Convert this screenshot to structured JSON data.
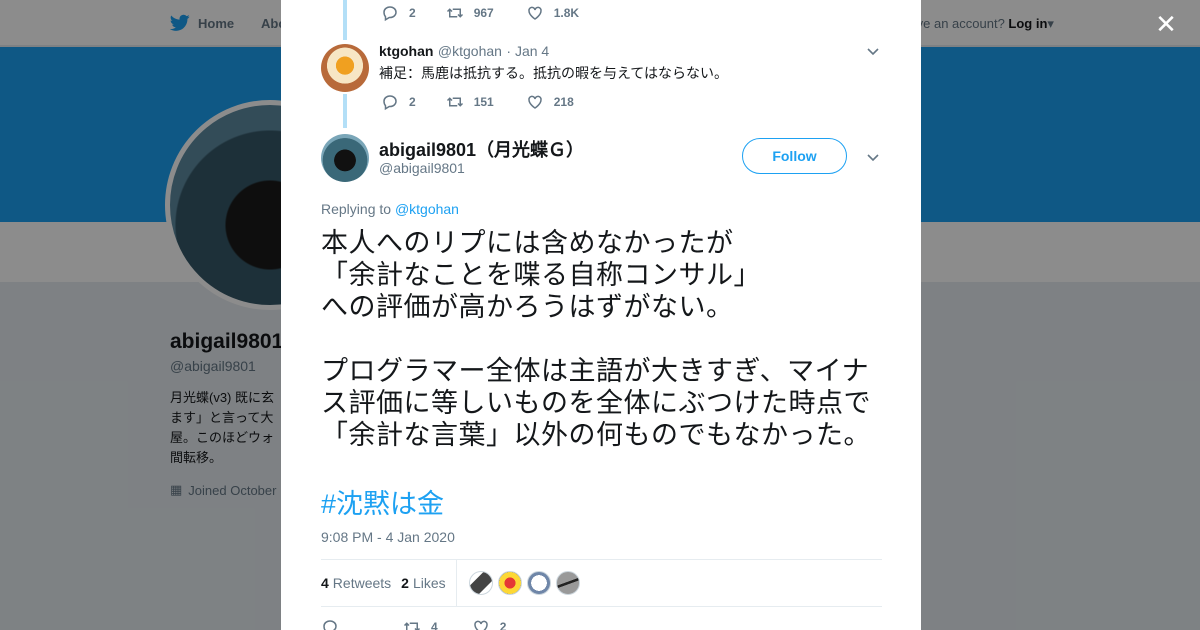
{
  "nav": {
    "home_label": "Home",
    "about_label": "About",
    "account_prompt": "Have an account?",
    "login_label": "Log in"
  },
  "background_profile": {
    "name": "abigail9801",
    "handle": "@abigail9801",
    "bio": "月光蝶(v3) 既に玄\nます」と言って大\n屋。このほどウォ\n間転移。",
    "joined": "Joined October"
  },
  "close_label": "✕",
  "tweet1_actions": {
    "replies": "2",
    "retweets": "967",
    "likes": "1.8K"
  },
  "tweet2": {
    "name": "ktgohan",
    "handle": "@ktgohan",
    "date": "· Jan 4",
    "text": "補足：馬鹿は抵抗する。抵抗の暇を与えてはならない。",
    "actions": {
      "replies": "2",
      "retweets": "151",
      "likes": "218"
    }
  },
  "main_tweet": {
    "name": "abigail9801（月光蝶Ｇ）",
    "handle": "@abigail9801",
    "follow_label": "Follow",
    "replying_prefix": "Replying to",
    "replying_to": "@ktgohan",
    "text": "本人へのリプには含めなかったが\n「余計なことを喋る自称コンサル」\nへの評価が高かろうはずがない。\n\nプログラマー全体は主語が大きすぎ、マイナス評価に等しいものを全体にぶつけた時点で「余計な言葉」以外の何ものでもなかった。",
    "hashtag": "#沈黙は金",
    "timestamp": "9:08 PM - 4 Jan 2020",
    "retweets_count": "4",
    "retweets_label": "Retweets",
    "likes_count": "2",
    "likes_label": "Likes",
    "actions": {
      "replies": "",
      "retweets": "4",
      "likes": "2"
    }
  },
  "colors": {
    "accent": "#1da1f2",
    "muted": "#657786",
    "like": "#e0245e"
  }
}
